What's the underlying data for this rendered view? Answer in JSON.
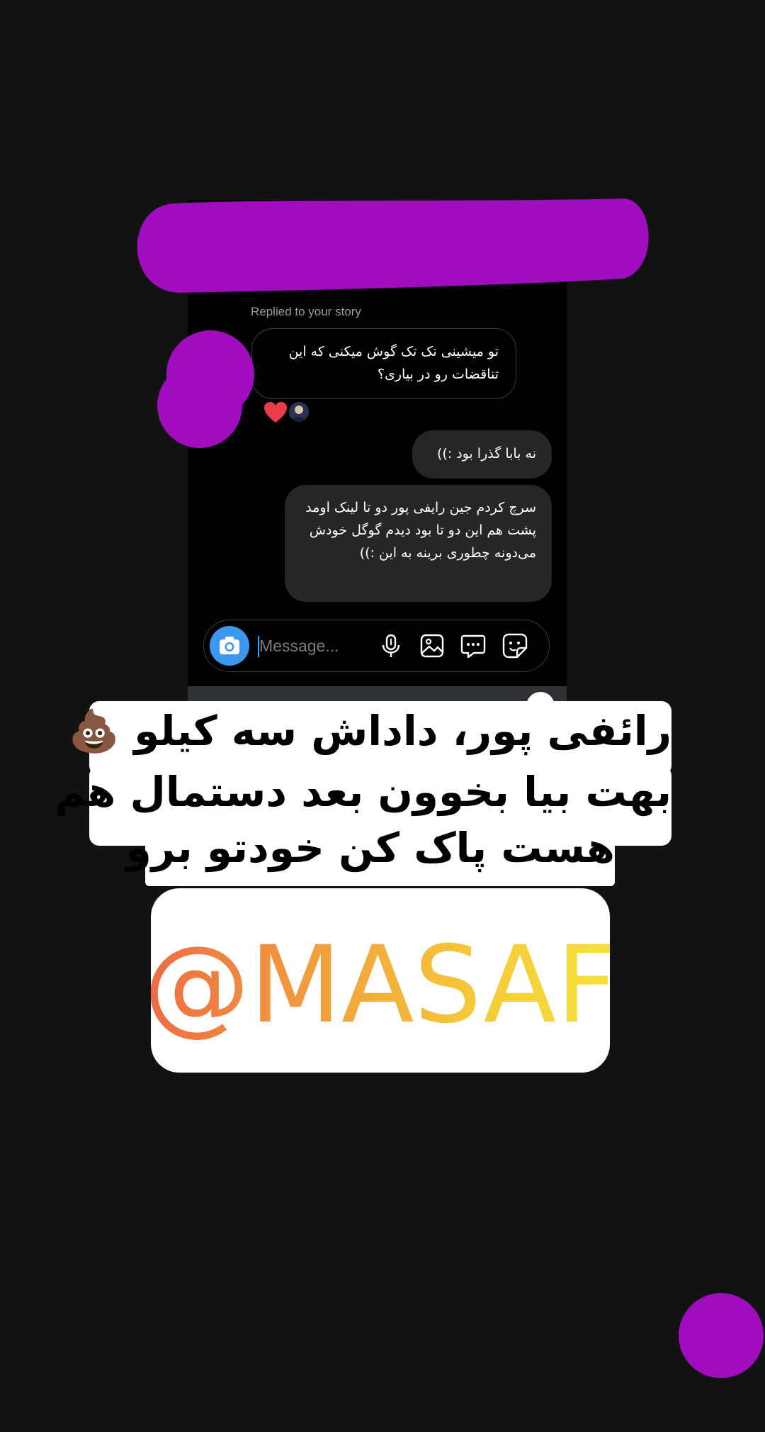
{
  "story_reply": {
    "replied_label": "Replied to your story",
    "incoming_message": "تو میشینی تک تک گوش میکنی که این تناقضات رو در بیاری؟",
    "reaction": "heart",
    "outgoing_messages": [
      "نه بابا گذرا بود :))",
      "سرچ کردم جین رایفی پور دو تا لینک اومد پشت هم این دو تا بود دیدم گوگل خودش می‌دونه چطوری برینه به این :))"
    ]
  },
  "composer": {
    "placeholder": "Message...",
    "icons": [
      "camera-icon",
      "microphone-icon",
      "gallery-icon",
      "chat-bubble-icon",
      "sticker-icon"
    ]
  },
  "caption": {
    "lines": [
      "رائفی پور، داداش سه کیلو 💩",
      "بهت بیا بخوون بعد دستمال هم",
      "هست پاک کن خودتو برو"
    ]
  },
  "mention": {
    "text": "@MASAF",
    "gradient": [
      "#ee6a43",
      "#f29c3c",
      "#f5c93a",
      "#f7e13a"
    ]
  },
  "colors": {
    "background": "#121212",
    "scribble": "#a10cbf",
    "bubble_out": "#262626",
    "accent": "#3b97f0"
  }
}
